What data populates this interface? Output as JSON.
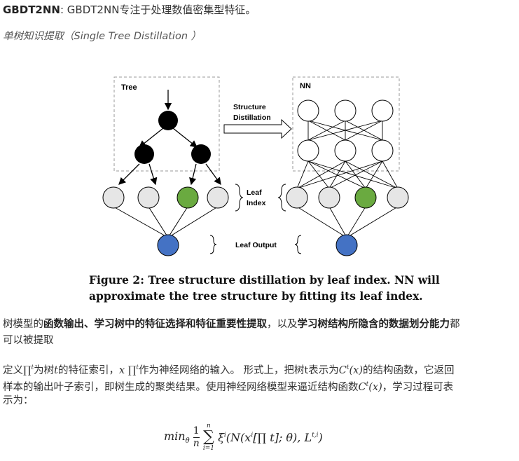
{
  "heading": {
    "term": "GBDT2NN",
    "rest": ": GBDT2NN专注于处理数值密集型特征。"
  },
  "subheading": "单树知识提取（Single Tree Distillation ）",
  "figure": {
    "tree_label": "Tree",
    "nn_label": "NN",
    "arrow_label_1": "Structure",
    "arrow_label_2": "Distillation",
    "leaf_index_1": "Leaf",
    "leaf_index_2": "Index",
    "leaf_output": "Leaf Output",
    "caption_1": "Figure 2: Tree structure distillation by leaf index. NN will",
    "caption_2": "approximate the tree structure by fitting its leaf index.",
    "colors": {
      "internal_node": "#000000",
      "leaf_node": "#e6e6e6",
      "selected_leaf": "#6aaa40",
      "output_node": "#4472c4",
      "box_border": "#999999"
    }
  },
  "para1": {
    "t1": "树模型的",
    "b1": "函数输出、学习树中的特征选择和特征重要性提取",
    "t2": "，以及",
    "b2": "学习树结构所隐含的数据划分能力",
    "t3": "都",
    "line2": "可以被提取"
  },
  "para2": {
    "s1": "定义",
    "s2": "为树",
    "s3": "的特征索引，",
    "s4": "作为神经网络的输入。 形式上，把树t表示为",
    "s5": "的结构函数，它返回",
    "line2a": "样本的输出叶子索引，即树生成的聚类结果。使用神经网络模型来逼近结构函数",
    "line2b": "，学习过程可表",
    "line3": "示为："
  },
  "formula": {
    "min": "min",
    "theta": "θ",
    "one": "1",
    "n": "n",
    "sum_top": "n",
    "sum_bottom": "i=1",
    "xi": "ξ",
    "body": "(N(x",
    "body2": "[∏ t]; θ), L",
    "close": ")"
  }
}
